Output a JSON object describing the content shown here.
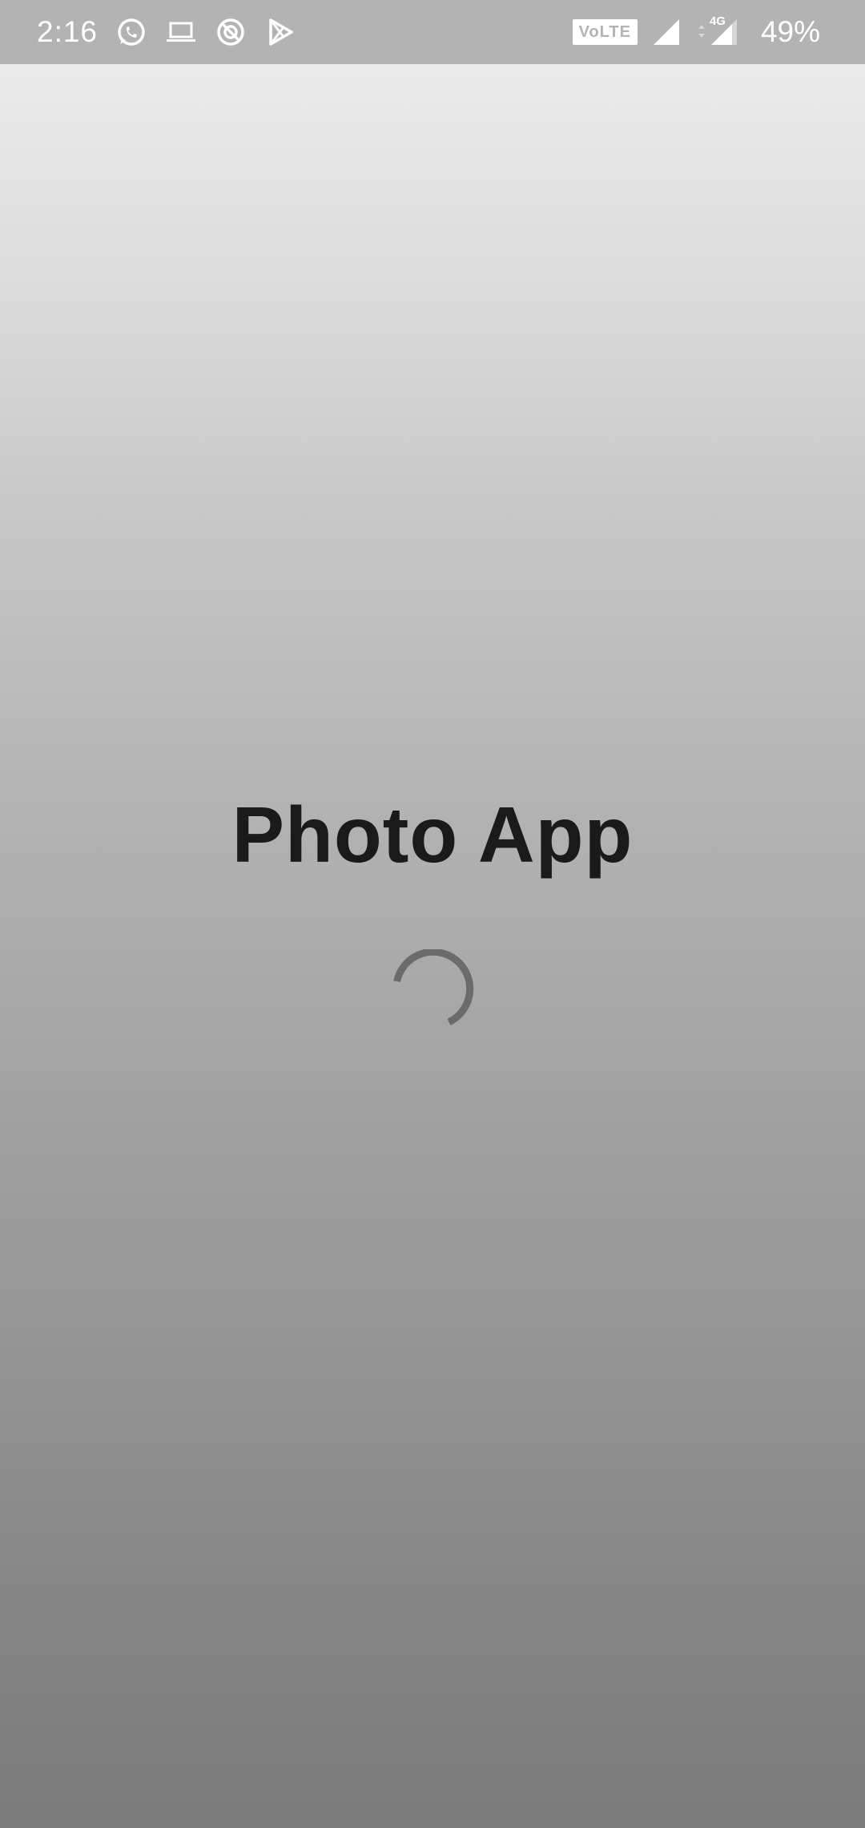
{
  "status_bar": {
    "time": "2:16",
    "left_icons": [
      "whatsapp-icon",
      "laptop-icon",
      "do-not-disturb-icon",
      "play-store-icon"
    ],
    "volte_label": "VoLTE",
    "network_type": "4G",
    "battery": "49%",
    "background": "#b3b3b3"
  },
  "splash": {
    "title": "Photo App",
    "loading": true,
    "spinner_color": "#6b6b6b"
  }
}
